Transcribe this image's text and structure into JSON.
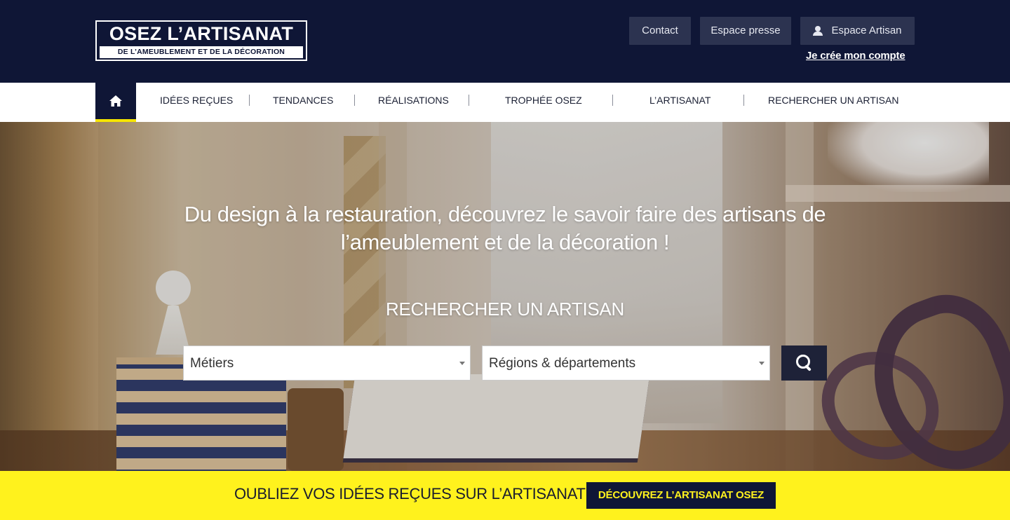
{
  "logo": {
    "title": "OSEZ L’ARTISANAT",
    "subtitle": "DE L’AMEUBLEMENT ET DE LA DÉCORATION"
  },
  "header": {
    "contact_label": "Contact",
    "presse_label": "Espace presse",
    "artisan_label": "Espace Artisan",
    "create_account_label": "Je crée mon compte"
  },
  "nav": {
    "home_icon": "home-icon",
    "items": [
      {
        "label": "IDÉES REÇUES"
      },
      {
        "label": "TENDANCES"
      },
      {
        "label": "RÉALISATIONS"
      },
      {
        "label": "TROPHÉE OSEZ"
      },
      {
        "label": "L’ARTISANAT"
      },
      {
        "label": "RECHERCHER UN ARTISAN"
      }
    ]
  },
  "hero": {
    "title": "Du design à la restauration, découvrez le savoir faire des artisans de l’ameublement et de la décoration !",
    "search_heading": "RECHERCHER UN ARTISAN",
    "metiers_select": "Métiers",
    "regions_select": "Régions & départements",
    "search_icon": "search-icon"
  },
  "banner": {
    "text": "OUBLIEZ VOS IDÉES REÇUES SUR L’ARTISANAT !",
    "button_label": "DÉCOUVREZ L’ARTISANAT OSEZ"
  },
  "colors": {
    "navy": "#0f1636",
    "button_gray": "#2c3350",
    "accent_yellow": "#fff21d",
    "white": "#ffffff"
  }
}
